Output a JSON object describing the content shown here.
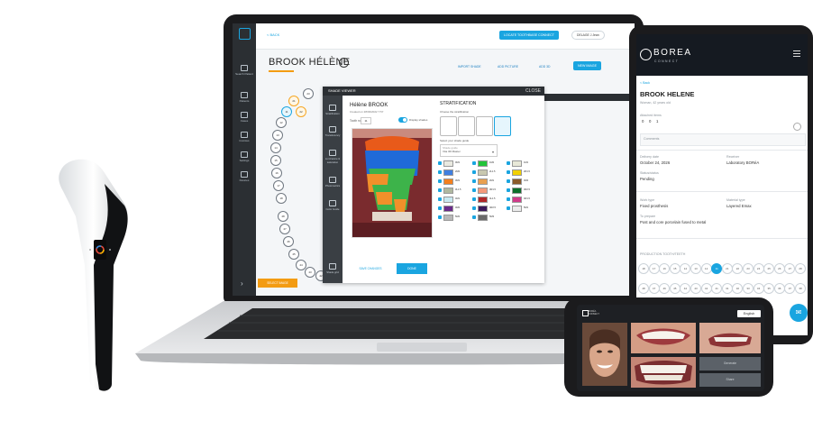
{
  "colors": {
    "accent": "#1aa5e0",
    "orange": "#f39c12",
    "dark": "#2b2f33"
  },
  "laptop": {
    "back_link": "< BACK",
    "header_button": "LOCATE TOOTHBASE CONNECT",
    "user": "DELAGE J Jean",
    "patient_title": "BROOK HÉLÈNE",
    "sidebar": [
      {
        "label": "Search Patient",
        "icon": "search-icon"
      },
      {
        "label": "Patients",
        "icon": "users-icon"
      },
      {
        "label": "Cases",
        "icon": "folder-icon"
      },
      {
        "label": "Invoices",
        "icon": "invoice-icon"
      },
      {
        "label": "Settings",
        "icon": "gear-icon"
      },
      {
        "label": "Devices",
        "icon": "device-icon"
      }
    ],
    "toolbar": [
      "IMPORT SHADE",
      "ADD PICTURE",
      "ADD 3D",
      "NEW IMAGE"
    ],
    "chart_hint": "Select a tooth",
    "chart_options": [
      "Present tooth",
      "3D model"
    ],
    "orange_button": "SELECT IMAGE",
    "shade_viewer": {
      "title": "SHADE VIEWER",
      "close": "CLOSE",
      "patient_name": "Hélène BROOK",
      "created": "Created on 28/03/2022 7:57",
      "tooth_no_label": "Tooth no.",
      "tooth_no": "11",
      "toggle_label": "Display shades",
      "side_items": [
        "Stratification",
        "Translucency",
        "Luminance & saturation",
        "Photometrics",
        "Color Guide",
        "Shade grid"
      ],
      "btn_save": "SAVE CHANGES",
      "btn_done": "DONE",
      "strat_title": "STRATIFICATION",
      "strat_sub": "Choose the stratification",
      "sg_label": "Select your shade guide",
      "sg_placeholder": "Shade guide",
      "sg_value": "Vita 3D Master",
      "shades": [
        {
          "name": "0M1",
          "color": "#e9e9e0"
        },
        {
          "name": "1M2",
          "color": "#22c43a"
        },
        {
          "name": "1M1",
          "color": "#e8e8d8"
        },
        {
          "name": "2M2",
          "color": "#3f7fe0"
        },
        {
          "name": "2L1.5",
          "color": "#c8c8b0"
        },
        {
          "name": "2R1.5",
          "color": "#f2d000"
        },
        {
          "name": "3M1",
          "color": "#f4801e"
        },
        {
          "name": "2M1",
          "color": "#e8a050"
        },
        {
          "name": "3M2",
          "color": "#8a5a2a"
        },
        {
          "name": "3L1.5",
          "color": "#b0b8a0"
        },
        {
          "name": "3R1.5",
          "color": "#f49a7a"
        },
        {
          "name": "3R2.5",
          "color": "#0b6e2a"
        },
        {
          "name": "4M1",
          "color": "#c8e8f0"
        },
        {
          "name": "4L1.5",
          "color": "#b02828"
        },
        {
          "name": "4R1.5",
          "color": "#d03a8a"
        },
        {
          "name": "4M2",
          "color": "#6a2a8a"
        },
        {
          "name": "4R2.5",
          "color": "#3a1a5a"
        },
        {
          "name": "5M1",
          "color": "#ececec"
        },
        {
          "name": "5M2",
          "color": "#b8b8b8"
        },
        {
          "name": "5M3",
          "color": "#6a6a6a"
        }
      ]
    }
  },
  "tablet": {
    "brand": "BOREA",
    "brand_sub": "CONNECT",
    "back": "< Back",
    "patient_name": "BROOK HELENE",
    "patient_info": "Woman, 42 years old",
    "attached_label": "Attached items",
    "attached_counts": [
      "0",
      "0",
      "1"
    ],
    "comments_label": "Comments",
    "delivery_label": "Delivery date",
    "delivery_value": "October 24, 2026",
    "receiver_label": "Receiver",
    "receiver_value": "Laboratory BORéA",
    "status_label": "Status/status",
    "status_value": "Pending",
    "work_label": "Work type",
    "work_value": "Fixed prosthesis",
    "material_label": "Material type",
    "material_value": "Layered Emax",
    "desc_label": "To prepare",
    "desc_value": "Post and core porcelain fused to metal",
    "teeth_header": "PRODUCTION TOOTH/TEETH",
    "teeth_row1": [
      "18",
      "17",
      "16",
      "15",
      "14",
      "13",
      "12",
      "11",
      "21",
      "22",
      "23",
      "24",
      "25",
      "26",
      "27",
      "28"
    ],
    "teeth_row2": [
      "48",
      "47",
      "46",
      "45",
      "44",
      "43",
      "42",
      "41",
      "31",
      "32",
      "33",
      "34",
      "35",
      "36",
      "37",
      "38"
    ],
    "selected_tooth": "11"
  },
  "phone": {
    "language": "English",
    "logo_text": "BORÉA CONNECT",
    "btn1": "Generate",
    "btn2": "Share"
  }
}
